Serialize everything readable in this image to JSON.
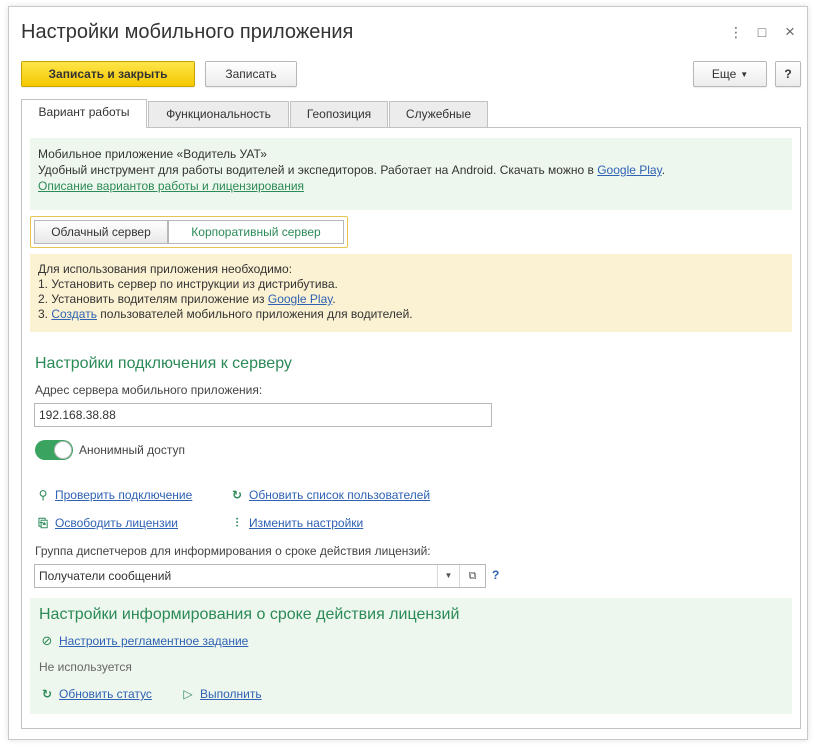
{
  "window": {
    "title": "Настройки мобильного приложения",
    "more_icon": "⋮",
    "maximize_icon": "□",
    "close_icon": "×"
  },
  "toolbar": {
    "save_close_label": "Записать и закрыть",
    "save_label": "Записать",
    "more_label": "Еще",
    "help_label": "?"
  },
  "tabs": [
    {
      "label": "Вариант работы",
      "active": true
    },
    {
      "label": "Функциональность",
      "active": false
    },
    {
      "label": "Геопозиция",
      "active": false
    },
    {
      "label": "Служебные",
      "active": false
    }
  ],
  "intro": {
    "line1": "Мобильное приложение «Водитель УАТ»",
    "line2": "Удобный инструмент для работы водителей и экспедиторов. Работает на Android. Скачать можно в ",
    "google_play_link": "Google Play",
    "line2_end": ".",
    "variants_link": "Описание вариантов работы и лицензирования"
  },
  "mode_switch": {
    "cloud_label": "Облачный сервер",
    "corporate_label": "Корпоративный сервер",
    "selected": "corporate"
  },
  "requirements": {
    "heading": "Для использования приложения необходимо:",
    "step1": "1. Установить сервер по инструкции из дистрибутива.",
    "step2_text": "2. Установить водителям приложение из ",
    "step2_link": "Google Play",
    "step2_end": ".",
    "step3_prefix": "3. ",
    "step3_link": "Создать",
    "step3_text": " пользователей мобильного приложения для водителей."
  },
  "connection": {
    "section_title": "Настройки подключения к серверу",
    "address_label": "Адрес сервера мобильного приложения:",
    "address_value": "192.168.38.88",
    "anonymous_label": "Анонимный доступ",
    "anonymous_enabled": true,
    "check_connection": "Проверить подключение",
    "refresh_users": "Обновить список пользователей",
    "release_licenses": "Освободить лицензии",
    "change_settings": "Изменить настройки",
    "group_label": "Группа диспетчеров для информирования о сроке действия лицензий:",
    "group_value": "Получатели сообщений",
    "help_mark": "?"
  },
  "license_info": {
    "section_title": "Настройки информирования о сроке действия лицензий",
    "setup_task": "Настроить регламентное задание",
    "status": "Не используется",
    "refresh_status": "Обновить статус",
    "execute": "Выполнить"
  },
  "icons": {
    "link_icon": "link-icon",
    "refresh_icon": "refresh-icon",
    "license_icon": "license-icon",
    "settings_icon": "settings-sliders-icon",
    "open_task_icon": "arrow-circle-icon",
    "play_icon": "play-icon"
  },
  "colors": {
    "accent_green": "#2b8a57",
    "link_blue": "#2f62b3",
    "primary_yellow": "#f4c800",
    "info_green_bg": "#eef7ee",
    "info_yellow_bg": "#fbf2d3",
    "toggle_on": "#3aa35f"
  }
}
